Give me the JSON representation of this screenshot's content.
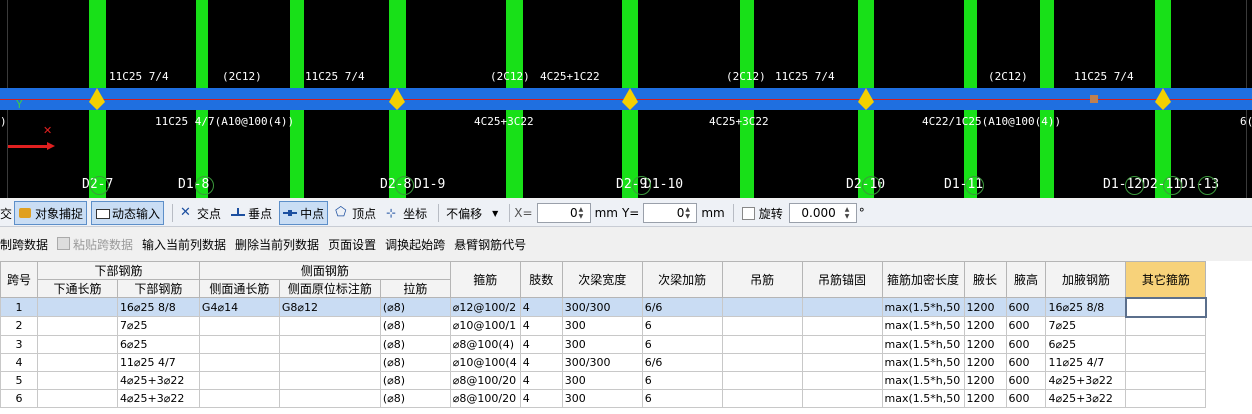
{
  "cad": {
    "axis_label": "Y",
    "top_labels": [
      "11C25 7/4",
      "(2C12)",
      "11C25 7/4",
      "(2C12)",
      "4C25+1C22",
      "(2C12)",
      "11C25 7/4",
      "(2C12)",
      "11C25 7/4"
    ],
    "mid_labels": [
      "11C25 4/7(A10@100(4))",
      "4C25+3C22",
      "4C25+3C22",
      "4C22/1C25(A10@100(4))",
      "6("
    ],
    "col_labels": [
      "D2-7",
      "D1-8",
      "D2-8",
      "D1-9",
      "D2-9",
      "D1-10",
      "D2-10",
      "D1-11",
      "D1-12",
      "D2-11",
      "D1-13"
    ],
    "left_edge_label": ")"
  },
  "toolbar1": {
    "cut_char": "交",
    "object_snap": "对象捕捉",
    "dynamic_input": "动态输入",
    "intersection": "交点",
    "perpendicular": "垂点",
    "midpoint": "中点",
    "vertex": "顶点",
    "coordinate": "坐标",
    "no_offset": "不偏移",
    "x_label": "X=",
    "x_value": "0",
    "x_unit": "mm",
    "y_label": "Y=",
    "y_value": "0",
    "y_unit": "mm",
    "rotate": "旋转",
    "rotate_value": "0.000",
    "degree": "°"
  },
  "toolbar2": {
    "items": [
      "制跨数据",
      "粘贴跨数据",
      "输入当前列数据",
      "删除当前列数据",
      "页面设置",
      "调换起始跨",
      "悬臂钢筋代号"
    ]
  },
  "table": {
    "group_headers": {
      "lower": "下部钢筋",
      "side": "侧面钢筋"
    },
    "headers": {
      "span": "跨号",
      "lower_through": "下通长筋",
      "lower_bar": "下部钢筋",
      "side_through": "侧面通长筋",
      "side_orig": "侧面原位标注筋",
      "tie": "拉筋",
      "stirrup": "箍筋",
      "legs": "肢数",
      "sec_width": "次梁宽度",
      "sec_bar": "次梁加筋",
      "hanger": "吊筋",
      "hanger_anchor": "吊筋锚固",
      "dense_len": "箍筋加密长度",
      "haunch_len": "腋长",
      "haunch_h": "腋高",
      "haunch_bar": "加腋钢筋",
      "other": "其它箍筋"
    },
    "rows": [
      {
        "span": "1",
        "lower_through": "",
        "lower_bar": "16⌀25 8/8",
        "side_through": "G4⌀14",
        "side_orig": "G8⌀12",
        "tie": "(⌀8)",
        "stirrup": "⌀12@100/2",
        "legs": "4",
        "sec_width": "300/300",
        "sec_bar": "6/6",
        "hanger": "",
        "hanger_anchor": "",
        "dense_len": "max(1.5*h,50",
        "haunch_len": "1200",
        "haunch_h": "600",
        "haunch_bar": "16⌀25 8/8",
        "other": ""
      },
      {
        "span": "2",
        "lower_through": "",
        "lower_bar": "7⌀25",
        "side_through": "",
        "side_orig": "",
        "tie": "(⌀8)",
        "stirrup": "⌀10@100/1",
        "legs": "4",
        "sec_width": "300",
        "sec_bar": "6",
        "hanger": "",
        "hanger_anchor": "",
        "dense_len": "max(1.5*h,50",
        "haunch_len": "1200",
        "haunch_h": "600",
        "haunch_bar": "7⌀25",
        "other": ""
      },
      {
        "span": "3",
        "lower_through": "",
        "lower_bar": "6⌀25",
        "side_through": "",
        "side_orig": "",
        "tie": "(⌀8)",
        "stirrup": "⌀8@100(4)",
        "legs": "4",
        "sec_width": "300",
        "sec_bar": "6",
        "hanger": "",
        "hanger_anchor": "",
        "dense_len": "max(1.5*h,50",
        "haunch_len": "1200",
        "haunch_h": "600",
        "haunch_bar": "6⌀25",
        "other": ""
      },
      {
        "span": "4",
        "lower_through": "",
        "lower_bar": "11⌀25 4/7",
        "side_through": "",
        "side_orig": "",
        "tie": "(⌀8)",
        "stirrup": "⌀10@100(4",
        "legs": "4",
        "sec_width": "300/300",
        "sec_bar": "6/6",
        "hanger": "",
        "hanger_anchor": "",
        "dense_len": "max(1.5*h,50",
        "haunch_len": "1200",
        "haunch_h": "600",
        "haunch_bar": "11⌀25 4/7",
        "other": ""
      },
      {
        "span": "5",
        "lower_through": "",
        "lower_bar": "4⌀25+3⌀22",
        "side_through": "",
        "side_orig": "",
        "tie": "(⌀8)",
        "stirrup": "⌀8@100/20",
        "legs": "4",
        "sec_width": "300",
        "sec_bar": "6",
        "hanger": "",
        "hanger_anchor": "",
        "dense_len": "max(1.5*h,50",
        "haunch_len": "1200",
        "haunch_h": "600",
        "haunch_bar": "4⌀25+3⌀22",
        "other": ""
      },
      {
        "span": "6",
        "lower_through": "",
        "lower_bar": "4⌀25+3⌀22",
        "side_through": "",
        "side_orig": "",
        "tie": "(⌀8)",
        "stirrup": "⌀8@100/20",
        "legs": "4",
        "sec_width": "300",
        "sec_bar": "6",
        "hanger": "",
        "hanger_anchor": "",
        "dense_len": "max(1.5*h,50",
        "haunch_len": "1200",
        "haunch_h": "600",
        "haunch_bar": "4⌀25+3⌀22",
        "other": ""
      }
    ]
  }
}
